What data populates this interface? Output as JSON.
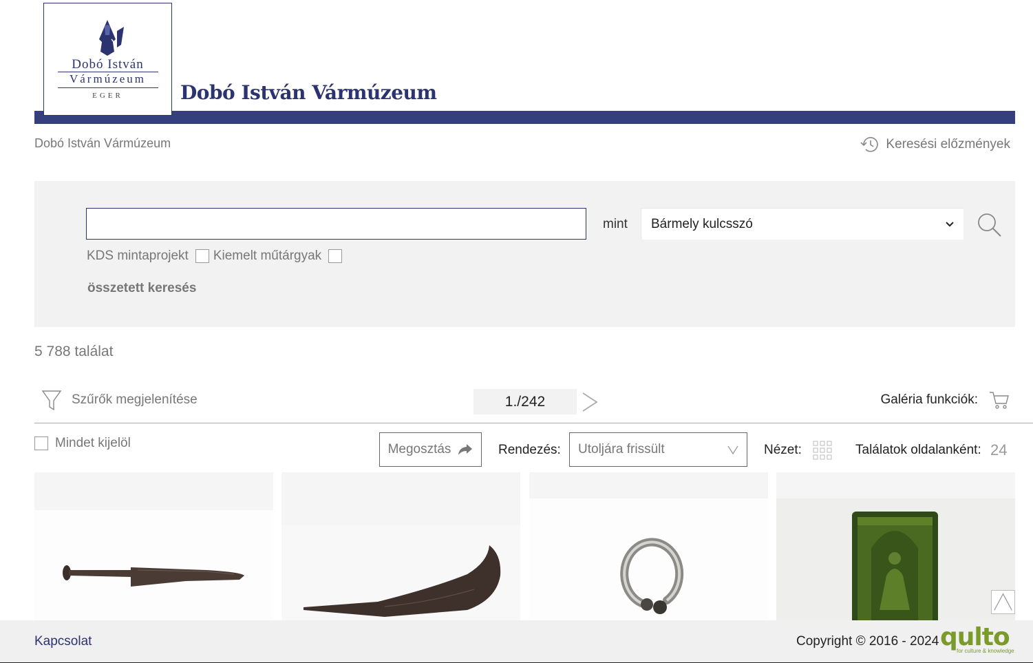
{
  "logo": {
    "line1": "Dobó István",
    "line2": "Vármúzeum",
    "line3": "EGER"
  },
  "header": {
    "title": "Dobó István Vármúzeum"
  },
  "breadcrumb": "Dobó István Vármúzeum",
  "history_label": "Keresési előzmények",
  "search": {
    "value": "",
    "as_label": "mint",
    "scope_value": "Bármely kulcsszó",
    "checkbox1_label": "KDS mintaprojekt",
    "checkbox2_label": "Kiemelt műtárgyak",
    "advanced_label": "összetett keresés"
  },
  "results": {
    "count_text": "5 788 találat"
  },
  "toolbar": {
    "filter_label": "Szűrők megjelenítése",
    "page_indicator": "1./242",
    "gallery_functions_label": "Galéria funkciók:",
    "select_all_label": "Mindet kijelöl",
    "share_label": "Megosztás",
    "sort_label": "Rendezés:",
    "sort_value": "Utoljára frissült",
    "view_label": "Nézet:",
    "per_page_label": "Találatok oldalanként:",
    "per_page_value": "24"
  },
  "footer": {
    "contact_label": "Kapcsolat",
    "copyright": "Copyright © 2016 - 2024",
    "brand": "qulto",
    "brand_tagline": "for culture & knowledge"
  },
  "colors": {
    "brand_navy": "#363f7e",
    "panel_gray": "#f2f2f2",
    "qulto_green": "#7a9a2a"
  }
}
